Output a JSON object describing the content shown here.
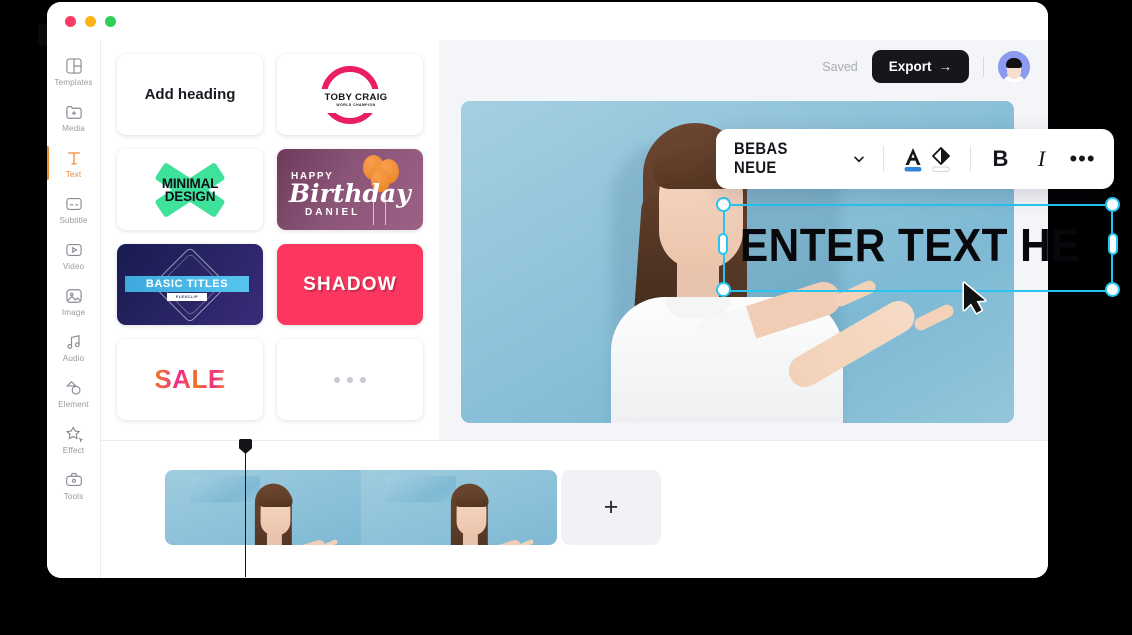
{
  "window": {
    "traffic_lights": [
      "close",
      "minimize",
      "maximize"
    ]
  },
  "sidebar": {
    "items": [
      {
        "label": "Templates",
        "icon": "templates-icon",
        "active": false
      },
      {
        "label": "Media",
        "icon": "media-add-icon",
        "active": false
      },
      {
        "label": "Text",
        "icon": "text-t-icon",
        "active": true
      },
      {
        "label": "Subtitle",
        "icon": "subtitle-icon",
        "active": false
      },
      {
        "label": "Video",
        "icon": "video-play-icon",
        "active": false
      },
      {
        "label": "Image",
        "icon": "image-icon",
        "active": false
      },
      {
        "label": "Audio",
        "icon": "audio-note-icon",
        "active": false
      },
      {
        "label": "Element",
        "icon": "element-icon",
        "active": false
      },
      {
        "label": "Effect",
        "icon": "effect-star-icon",
        "active": false
      },
      {
        "label": "Tools",
        "icon": "tools-case-icon",
        "active": false
      }
    ],
    "accent_color": "#f0892e"
  },
  "templates_panel": {
    "cards": [
      {
        "id": "add-heading",
        "title": "Add heading"
      },
      {
        "id": "toby-craig",
        "title": "TOBY CRAIG",
        "subtitle": "WORLD CHAMPION"
      },
      {
        "id": "minimal-design",
        "line1": "MINIMAL",
        "line2": "DESIGN"
      },
      {
        "id": "happy-birthday",
        "line1": "HAPPY",
        "line2": "Birthday",
        "line3": "DANIEL"
      },
      {
        "id": "basic-titles",
        "title": "BASIC TITLES",
        "subtitle": "FLEXCLIP"
      },
      {
        "id": "shadow",
        "title": "SHADOW"
      },
      {
        "id": "sale",
        "title": "SALE"
      },
      {
        "id": "more",
        "title": "•••"
      }
    ]
  },
  "editor_header": {
    "saved_label": "Saved",
    "export_label": "Export",
    "export_arrow": "→",
    "avatar": "user-avatar"
  },
  "text_toolbar": {
    "font_name": "BEBAS NEUE",
    "chevron": "chevron-down-icon",
    "text_color_label": "A",
    "text_color_swatch": "#2f86d6",
    "fill_color_label": "fill-bucket-icon",
    "fill_color_swatch": "#ffffff",
    "bold_label": "B",
    "italic_label": "I",
    "more_label": "•••"
  },
  "canvas": {
    "text_element": {
      "value": "ENTER TEXT HERE",
      "selected": true,
      "selection_color": "#26c6f0",
      "handles": [
        "top-left",
        "top-right",
        "bottom-left",
        "bottom-right",
        "middle-left",
        "middle-right"
      ]
    },
    "cursor": "arrow-cursor"
  },
  "timeline": {
    "playhead": "playhead",
    "clips": [
      {
        "id": "clip-1",
        "label": ""
      },
      {
        "id": "clip-2",
        "label": ""
      }
    ],
    "add_button_label": "+"
  }
}
